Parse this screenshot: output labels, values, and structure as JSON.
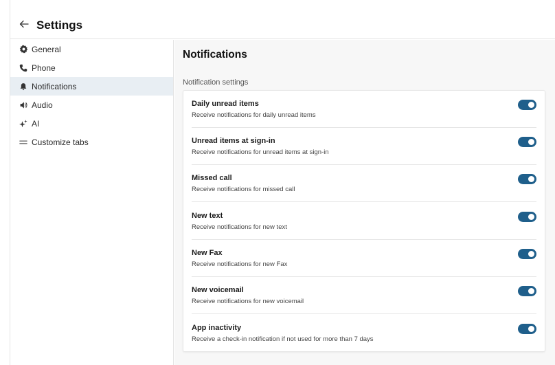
{
  "header": {
    "title": "Settings",
    "back_icon": "arrow-left-icon"
  },
  "sidebar": {
    "items": [
      {
        "label": "General",
        "icon": "gear-icon",
        "active": false
      },
      {
        "label": "Phone",
        "icon": "phone-icon",
        "active": false
      },
      {
        "label": "Notifications",
        "icon": "bell-icon",
        "active": true
      },
      {
        "label": "Audio",
        "icon": "speaker-icon",
        "active": false
      },
      {
        "label": "AI",
        "icon": "sparkle-icon",
        "active": false
      },
      {
        "label": "Customize tabs",
        "icon": "lines-icon",
        "active": false
      }
    ]
  },
  "main": {
    "title": "Notifications",
    "section_label": "Notification settings",
    "settings": [
      {
        "title": "Daily unread items",
        "description": "Receive notifications for daily unread items",
        "enabled": true
      },
      {
        "title": "Unread items at sign-in",
        "description": "Receive notifications for unread items at sign-in",
        "enabled": true
      },
      {
        "title": "Missed call",
        "description": "Receive notifications for missed call",
        "enabled": true
      },
      {
        "title": "New text",
        "description": "Receive notifications for new text",
        "enabled": true
      },
      {
        "title": "New Fax",
        "description": "Receive notifications for new Fax",
        "enabled": true
      },
      {
        "title": "New voicemail",
        "description": "Receive notifications for new voicemail",
        "enabled": true
      },
      {
        "title": "App inactivity",
        "description": "Receive a check-in notification if not used for more than 7 days",
        "enabled": true
      }
    ]
  },
  "colors": {
    "toggle_on": "#1f5f8b",
    "active_nav_bg": "#e8eef3"
  }
}
